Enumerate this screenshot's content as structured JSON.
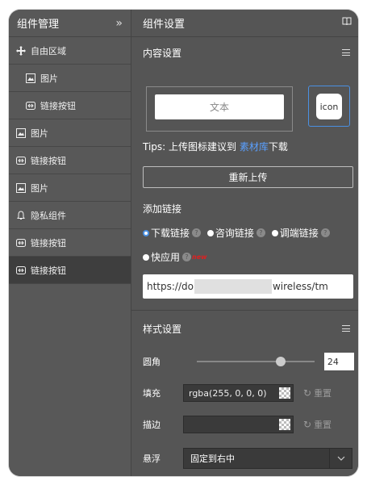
{
  "left": {
    "title": "组件管理",
    "items": [
      {
        "label": "自由区域"
      },
      {
        "label": "图片"
      },
      {
        "label": "链接按钮"
      },
      {
        "label": "图片"
      },
      {
        "label": "链接按钮"
      },
      {
        "label": "图片"
      },
      {
        "label": "隐私组件"
      },
      {
        "label": "链接按钮"
      },
      {
        "label": "链接按钮"
      }
    ]
  },
  "right": {
    "title": "组件设置",
    "content": {
      "title": "内容设置",
      "preview_button": "文本",
      "icon_label": "icon",
      "tips_prefix": "Tips: 上传图标建议到 ",
      "tips_link": "素材库",
      "tips_suffix": "下载",
      "reupload": "重新上传",
      "add_link": "添加链接",
      "radio_download": "下载链接",
      "radio_consult": "咨询链接",
      "radio_invoke": "调端链接",
      "radio_quickapp": "快应用",
      "new_badge": "new",
      "url_start": "https://do",
      "url_end": "wireless/tm"
    },
    "style": {
      "title": "样式设置",
      "radius_label": "圆角",
      "radius_value": "24",
      "fill_label": "填充",
      "fill_value": "rgba(255, 0, 0, 0)",
      "stroke_label": "描边",
      "stroke_value": "",
      "reset": "重置",
      "float_label": "悬浮",
      "float_value": "固定到右中"
    }
  },
  "colors": {
    "link": "#5aa0ff",
    "accent": "#4a90e2",
    "new": "#e02020"
  }
}
